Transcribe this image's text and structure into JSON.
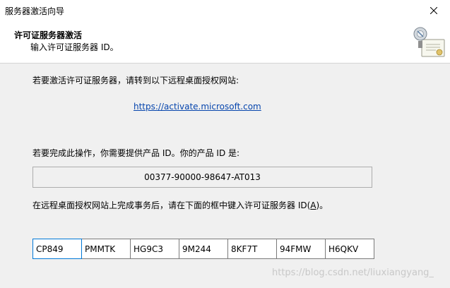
{
  "window": {
    "title": "服务器激活向导"
  },
  "header": {
    "title": "许可证服务器激活",
    "subtitle": "输入许可证服务器 ID。",
    "icon": "certificate-icon"
  },
  "body": {
    "instruction_visit": "若要激活许可证服务器，请转到以下远程桌面授权网站:",
    "activation_url": "https://activate.microsoft.com",
    "instruction_product_id": "若要完成此操作，你需要提供产品 ID。你的产品 ID 是:",
    "product_id": "00377-90000-98647-AT013",
    "instruction_enter_prefix": "在远程桌面授权网站上完成事务后，请在下面的框中键入许可证服务器 ID(",
    "instruction_enter_accesskey": "A",
    "instruction_enter_suffix": ")。",
    "server_id_fields": [
      "CP849",
      "PMMTK",
      "HG9C3",
      "9M244",
      "8KF7T",
      "94FMW",
      "H6QKV"
    ]
  },
  "watermark": "https://blog.csdn.net/liuxiangyang_"
}
